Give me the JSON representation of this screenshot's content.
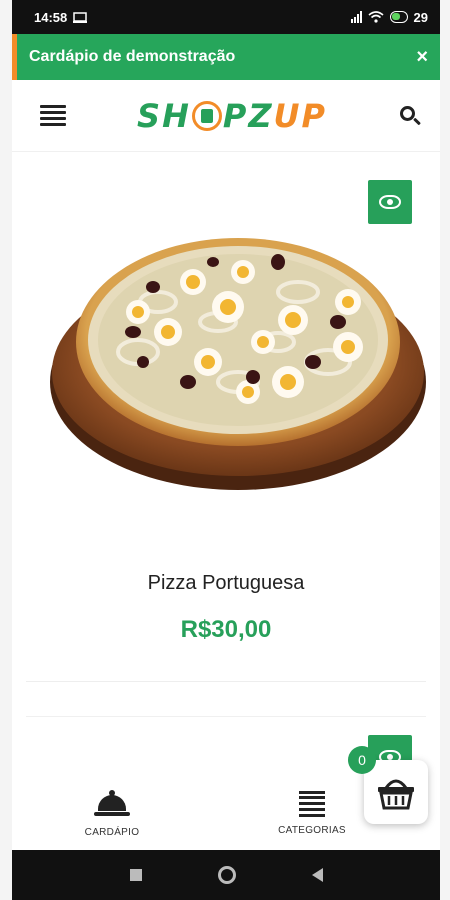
{
  "status_bar": {
    "time": "14:58",
    "battery": "29"
  },
  "banner": {
    "text": "Cardápio de demonstração",
    "close": "×"
  },
  "header": {
    "logo_part1": "SH",
    "logo_part2": "PZ",
    "logo_part3": "UP"
  },
  "product": {
    "name": "Pizza Portuguesa",
    "price": "R$30,00"
  },
  "cart": {
    "count": "0"
  },
  "bottom_nav": {
    "items": [
      {
        "label": "CARDÁPIO",
        "icon": "cloche-icon"
      },
      {
        "label": "CATEGORIAS",
        "icon": "list-icon"
      }
    ]
  },
  "colors": {
    "brand_green": "#27a05a",
    "brand_orange": "#f28c28",
    "banner_green": "#26a65b"
  }
}
